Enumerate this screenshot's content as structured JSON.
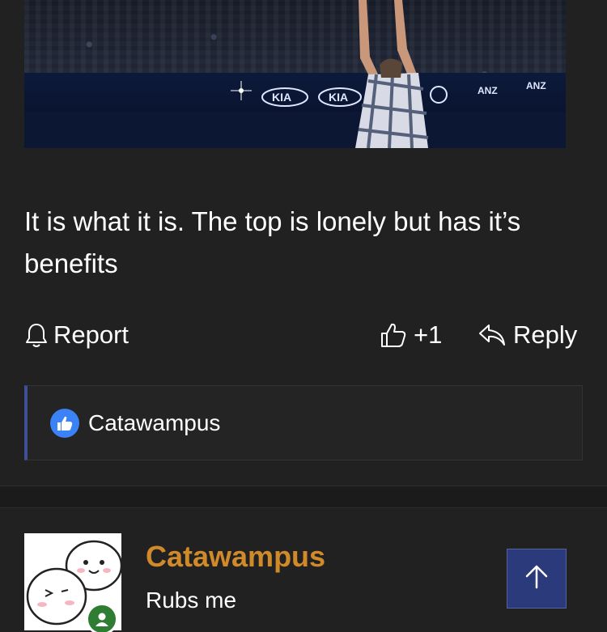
{
  "post": {
    "image_alt": "Tennis player celebrating on court",
    "image_text": [
      "KIA",
      "KIA",
      "ANZ",
      "ANZ"
    ],
    "text": "It is what it is. The top is lonely but has it’s benefits"
  },
  "actions": {
    "report_label": "Report",
    "like_count": "+1",
    "reply_label": "Reply"
  },
  "reactions": {
    "icon": "thumbs-up-icon",
    "user": "Catawampus"
  },
  "next_comment": {
    "username": "Catawampus",
    "text": "Rubs me"
  },
  "colors": {
    "background": "#212121",
    "username": "#d08a2a",
    "accent_bar": "#3f4f9a",
    "scroll_top_bg": "#2b3a7a",
    "like_blue": "#3b82f6",
    "badge_green": "#2f7d32"
  }
}
